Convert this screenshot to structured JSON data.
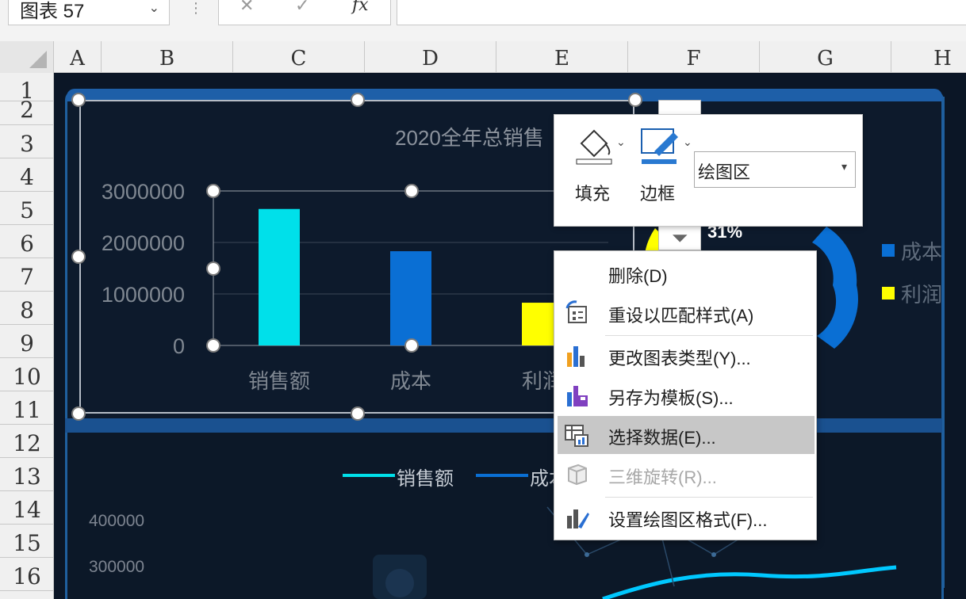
{
  "formula_bar": {
    "name_box": "图表 57",
    "buttons": [
      "✕",
      "✓",
      "fx"
    ]
  },
  "columns": [
    "A",
    "B",
    "C",
    "D",
    "E",
    "F",
    "G",
    "H"
  ],
  "rows": [
    "1",
    "2",
    "3",
    "4",
    "5",
    "6",
    "7",
    "8",
    "9",
    "10",
    "11",
    "12",
    "13",
    "14",
    "15",
    "16"
  ],
  "colors": {
    "sales": "#00e0ea",
    "cost": "#0a6fd4",
    "profit": "#ffff00",
    "dashboard_bg": "#0b1626",
    "frame": "#1f5f9e"
  },
  "chart_data": [
    {
      "type": "bar",
      "title": "2020全年总销售",
      "categories": [
        "销售额",
        "成本",
        "利润"
      ],
      "values": [
        2650000,
        1830000,
        830000
      ],
      "ylim": [
        0,
        3000000
      ],
      "yticks": [
        "0",
        "1000000",
        "2000000",
        "3000000"
      ],
      "grid": true
    },
    {
      "type": "pie",
      "legend": [
        "成本",
        "利润"
      ],
      "data_labels": [
        "31%"
      ]
    },
    {
      "type": "line",
      "series": [
        {
          "name": "销售额"
        },
        {
          "name": "成本"
        }
      ],
      "yticks": [
        "400000",
        "300000"
      ]
    }
  ],
  "mini_toolbar": {
    "fill_label": "填充",
    "border_label": "边框",
    "element_selector": "绘图区"
  },
  "context_menu": {
    "items": [
      {
        "label": "删除(D)",
        "icon": "none",
        "enabled": true,
        "highlighted": false
      },
      {
        "label": "重设以匹配样式(A)",
        "icon": "reset-style-icon",
        "enabled": true,
        "highlighted": false
      },
      {
        "label": "更改图表类型(Y)...",
        "icon": "chart-type-icon",
        "enabled": true,
        "highlighted": false
      },
      {
        "label": "另存为模板(S)...",
        "icon": "save-template-icon",
        "enabled": true,
        "highlighted": false
      },
      {
        "label": "选择数据(E)...",
        "icon": "select-data-icon",
        "enabled": true,
        "highlighted": true
      },
      {
        "label": "三维旋转(R)...",
        "icon": "3d-rotate-icon",
        "enabled": false,
        "highlighted": false
      },
      {
        "label": "设置绘图区格式(F)...",
        "icon": "format-plot-area-icon",
        "enabled": true,
        "highlighted": false
      }
    ]
  }
}
